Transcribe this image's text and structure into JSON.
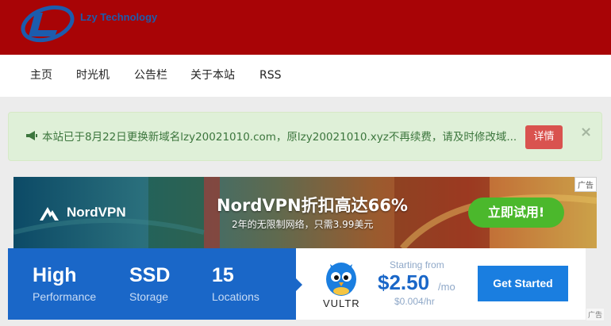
{
  "header": {
    "logo_icon": "lzy-logo-icon",
    "site_name": "Lzy Technology",
    "background": "#a80406"
  },
  "nav": {
    "items": [
      {
        "label": "主页"
      },
      {
        "label": "时光机"
      },
      {
        "label": "公告栏"
      },
      {
        "label": "关于本站"
      },
      {
        "label": "RSS"
      }
    ]
  },
  "notice": {
    "icon": "megaphone-icon",
    "text": "本站已于8月22日更换新域名lzy20021010.com，原lzy20021010.xyz不再续费，请及时修改域...",
    "detail_label": "详情",
    "close_label": "×"
  },
  "ad_nordvpn": {
    "brand": "NordVPN",
    "headline": "NordVPN折扣高达66%",
    "subline": "2年的无限制网络，只需3.99美元",
    "cta": "立即试用!",
    "ad_tag": "广告"
  },
  "ad_vultr": {
    "features": [
      {
        "big": "High",
        "small": "Performance"
      },
      {
        "big": "SSD",
        "small": "Storage"
      },
      {
        "big": "15",
        "small": "Locations"
      }
    ],
    "brand": "VULTR",
    "starting_from": "Starting from",
    "price": "$2.50",
    "price_unit": "/mo",
    "price_hour": "$0.004/hr",
    "cta": "Get Started",
    "ad_tag": "广告"
  }
}
